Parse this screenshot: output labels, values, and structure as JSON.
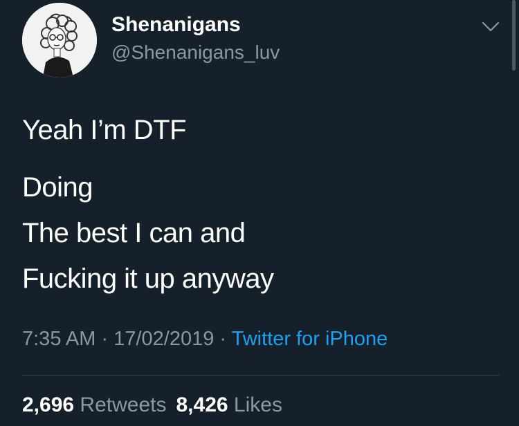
{
  "author": {
    "display_name": "Shenanigans",
    "handle": "@Shenanigans_luv",
    "avatar_icon": "profile-avatar-illustration"
  },
  "tweet": {
    "first_line": "Yeah I’m DTF",
    "lines": [
      "Doing",
      "The best I can and",
      "Fucking it up anyway"
    ]
  },
  "meta": {
    "time": "7:35 AM",
    "separator": " · ",
    "date": "17/02/2019",
    "source": "Twitter for iPhone"
  },
  "stats": {
    "retweets_count": "2,696",
    "retweets_label": "Retweets",
    "likes_count": "8,426",
    "likes_label": "Likes"
  },
  "icons": {
    "caret": "chevron-down-icon"
  },
  "colors": {
    "background": "#15202b",
    "text": "#ffffff",
    "secondary_text": "#8899a6",
    "link": "#1da1f2",
    "divider": "#38444d"
  }
}
